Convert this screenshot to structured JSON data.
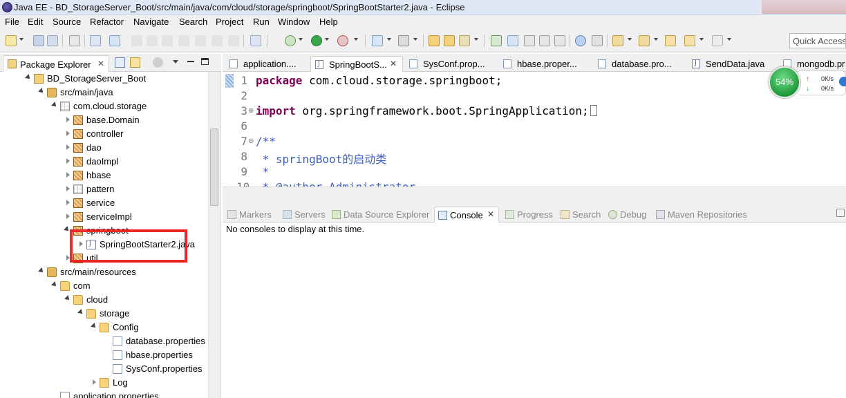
{
  "window": {
    "title": "Java EE - BD_StorageServer_Boot/src/main/java/com/cloud/storage/springboot/SpringBootStarter2.java - Eclipse"
  },
  "menu": [
    "File",
    "Edit",
    "Source",
    "Refactor",
    "Navigate",
    "Search",
    "Project",
    "Run",
    "Window",
    "Help"
  ],
  "quick_access": {
    "placeholder": "Quick Access"
  },
  "package_explorer": {
    "tab_label": "Package Explorer",
    "tree": [
      {
        "label": "BD_StorageServer_Boot",
        "icon": "project-icon",
        "expanded": true
      },
      {
        "label": "src/main/java",
        "icon": "source-folder-icon",
        "expanded": true
      },
      {
        "label": "com.cloud.storage",
        "icon": "package-icon-empty",
        "expanded": true
      },
      {
        "label": "base.Domain",
        "icon": "package-icon",
        "expanded": false
      },
      {
        "label": "controller",
        "icon": "package-icon",
        "expanded": false
      },
      {
        "label": "dao",
        "icon": "package-icon",
        "expanded": false
      },
      {
        "label": "daoImpl",
        "icon": "package-icon",
        "expanded": false
      },
      {
        "label": "hbase",
        "icon": "package-icon",
        "expanded": false
      },
      {
        "label": "pattern",
        "icon": "package-icon-empty",
        "expanded": false
      },
      {
        "label": "service",
        "icon": "package-icon",
        "expanded": false
      },
      {
        "label": "serviceImpl",
        "icon": "package-icon",
        "expanded": false
      },
      {
        "label": "springboot",
        "icon": "package-icon",
        "expanded": true
      },
      {
        "label": "SpringBootStarter2.java",
        "icon": "java-file-icon",
        "expanded": false,
        "selected": true
      },
      {
        "label": "util",
        "icon": "package-icon",
        "expanded": false
      },
      {
        "label": "src/main/resources",
        "icon": "source-folder-icon",
        "expanded": true
      },
      {
        "label": "com",
        "icon": "folder-icon",
        "expanded": true
      },
      {
        "label": "cloud",
        "icon": "folder-icon",
        "expanded": true
      },
      {
        "label": "storage",
        "icon": "folder-icon",
        "expanded": true
      },
      {
        "label": "Config",
        "icon": "folder-icon",
        "expanded": true
      },
      {
        "label": "database.properties",
        "icon": "file-icon"
      },
      {
        "label": "hbase.properties",
        "icon": "file-icon"
      },
      {
        "label": "SysConf.properties",
        "icon": "file-icon"
      },
      {
        "label": "Log",
        "icon": "folder-icon",
        "expanded": false
      },
      {
        "label": "application.properties",
        "icon": "file-icon"
      }
    ]
  },
  "editor": {
    "tabs": [
      {
        "label": "application....",
        "icon": "properties-file-icon"
      },
      {
        "label": "SpringBootS...",
        "icon": "java-file-icon",
        "active": true
      },
      {
        "label": "SysConf.prop...",
        "icon": "properties-file-icon"
      },
      {
        "label": "hbase.proper...",
        "icon": "properties-file-icon"
      },
      {
        "label": "database.pro...",
        "icon": "properties-file-icon"
      },
      {
        "label": "SendData.java",
        "icon": "java-file-icon"
      },
      {
        "label": "mongodb.pr",
        "icon": "properties-file-icon"
      }
    ],
    "lines": [
      {
        "num": "1",
        "pre": "",
        "kw": "package",
        "rest": " com.cloud.storage.springboot;"
      },
      {
        "num": "2",
        "pre": "",
        "kw": "",
        "rest": ""
      },
      {
        "num": "3",
        "pre": "",
        "kw": "import",
        "rest": " org.springframework.boot.SpringApplication;"
      },
      {
        "num": "6",
        "pre": "",
        "kw": "",
        "rest": ""
      },
      {
        "num": "7",
        "pre": "",
        "kw": "",
        "rest": "/**"
      },
      {
        "num": "8",
        "pre": "",
        "kw": "",
        "rest": " * springBoot的启动类"
      },
      {
        "num": "9",
        "pre": "",
        "kw": "",
        "rest": " *"
      },
      {
        "num": "10",
        "pre": "",
        "kw": "",
        "rest": " * @author Administrator"
      }
    ]
  },
  "speed_widget": {
    "percent": "54%",
    "up": "0K/s",
    "down": "0K/s"
  },
  "bottom_panel": {
    "tabs": [
      {
        "label": "Markers",
        "icon": "markers-icon"
      },
      {
        "label": "Servers",
        "icon": "servers-icon"
      },
      {
        "label": "Data Source Explorer",
        "icon": "data-source-icon"
      },
      {
        "label": "Console",
        "icon": "console-icon",
        "active": true
      },
      {
        "label": "Progress",
        "icon": "progress-icon"
      },
      {
        "label": "Search",
        "icon": "search-icon"
      },
      {
        "label": "Debug",
        "icon": "debug-icon"
      },
      {
        "label": "Maven Repositories",
        "icon": "maven-repo-icon"
      }
    ],
    "console_message": "No consoles to display at this time."
  },
  "colors": {
    "keyword": "#7f0055",
    "javadoc": "#3f5fbf",
    "highlight_box": "#ec2727",
    "toolbar_bg": "#f0f0f0"
  }
}
